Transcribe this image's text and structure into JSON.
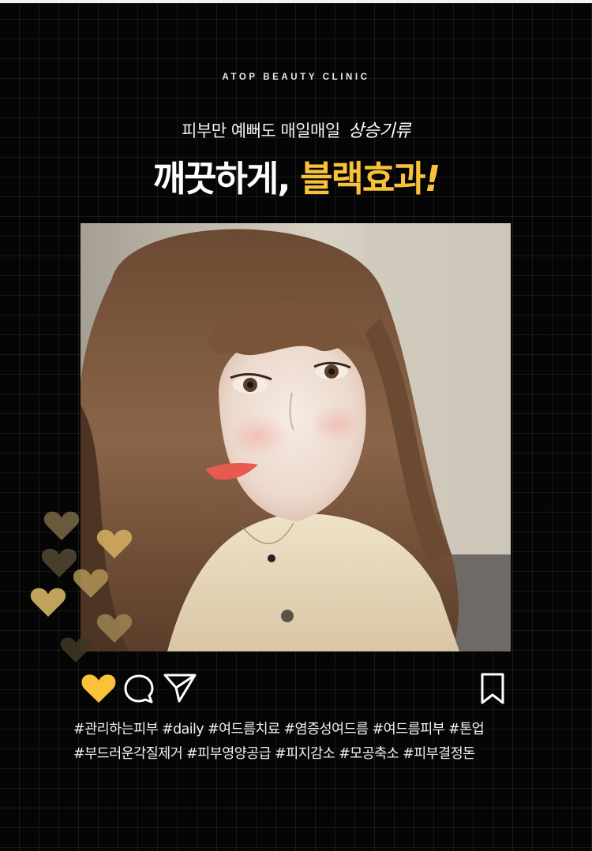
{
  "brand": "ATOP BEAUTY CLINIC",
  "subtitle": {
    "text": "피부만 예뻐도 매일매일",
    "script": "상승기류"
  },
  "headline": {
    "white": "깨끗하게,",
    "accent": "블랙효과",
    "exclaim": "!"
  },
  "colors": {
    "accent": "#f8c23a",
    "background": "#050505",
    "grid": "#1b1b1b",
    "text": "#f1f1f1"
  },
  "photo": {
    "subject": "selfie-portrait"
  },
  "actions": {
    "like_icon": "heart-icon",
    "comment_icon": "comment-icon",
    "share_icon": "send-icon",
    "save_icon": "bookmark-icon"
  },
  "hashtags": {
    "line1": "#관리하는피부 #daily #여드름치료 #염증성여드름 #여드름피부 #톤업",
    "line2": "#부드러운각질제거 #피부영양공급 #피지감소 #모공축소 #피부결정돈"
  }
}
